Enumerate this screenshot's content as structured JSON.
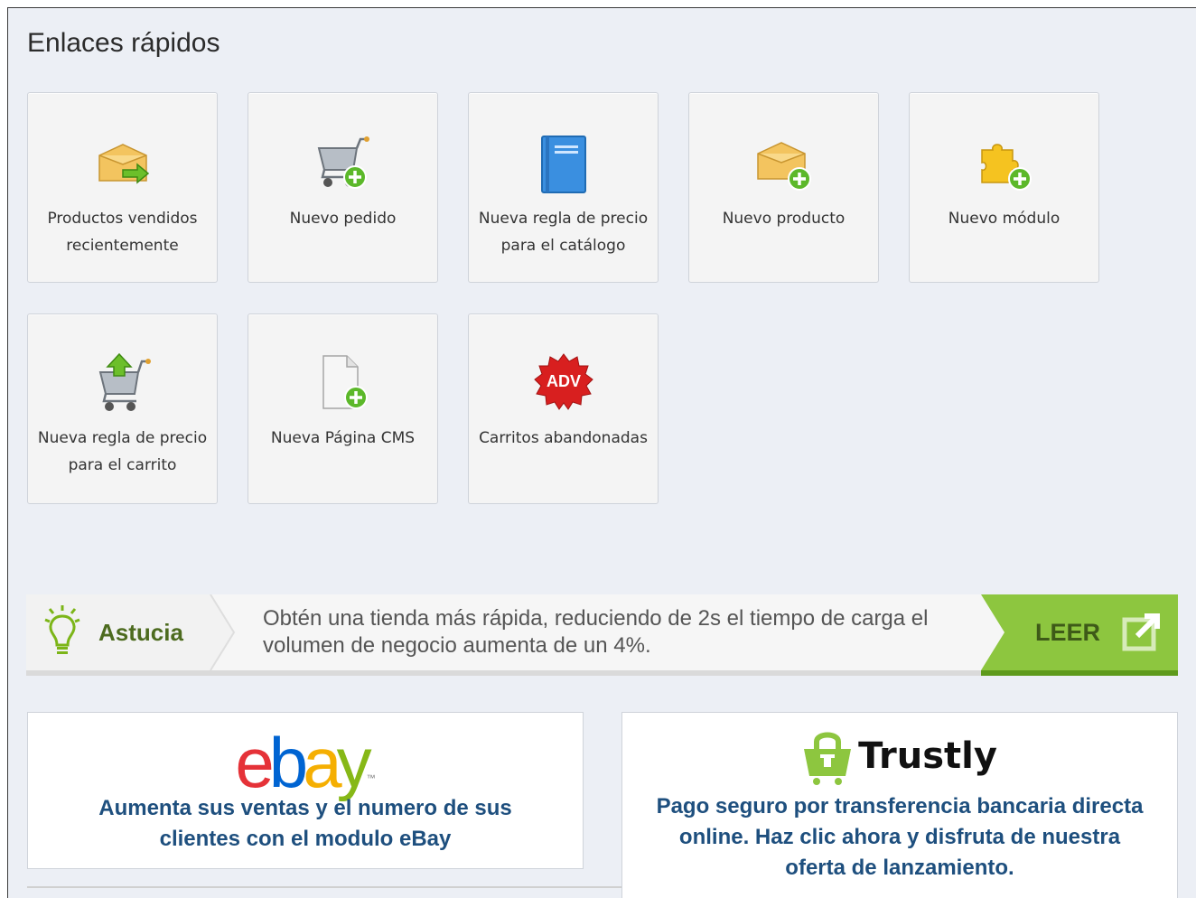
{
  "quick_links": {
    "title": "Enlaces rápidos",
    "tiles": [
      {
        "label": "Productos vendidos recientemente",
        "icon": "box-arrow-icon"
      },
      {
        "label": "Nuevo pedido",
        "icon": "cart-add-icon"
      },
      {
        "label": "Nueva regla de precio para el catálogo",
        "icon": "book-icon"
      },
      {
        "label": "Nuevo producto",
        "icon": "box-add-icon"
      },
      {
        "label": "Nuevo módulo",
        "icon": "puzzle-add-icon"
      },
      {
        "label": "Nueva regla de precio para el carrito",
        "icon": "cart-up-icon"
      },
      {
        "label": "Nueva Página CMS",
        "icon": "page-add-icon"
      },
      {
        "label": "Carritos abandonadas",
        "icon": "adv-badge-icon",
        "badge_text": "ADV"
      }
    ]
  },
  "tip": {
    "label": "Astucia",
    "text": "Obtén una tienda más rápida, reduciendo de 2s el tiempo de carga el volumen de negocio aumenta de un 4%.",
    "button": "LEER",
    "accent": "#8bc34a"
  },
  "promos": {
    "ebay": {
      "logo": [
        "e",
        "b",
        "a",
        "y"
      ],
      "tm": "™",
      "text": "Aumenta sus ventas y el numero de sus clientes con el modulo eBay"
    },
    "trustly": {
      "logo": "Trustly",
      "text": "Pago seguro por transferencia bancaria directa online. Haz clic ahora y disfruta de nuestra oferta de lanzamiento."
    }
  },
  "colors": {
    "text_blue": "#1e4f7e",
    "ebay_e": "#e53238",
    "ebay_b": "#0064d2",
    "ebay_a": "#f5af02",
    "ebay_y": "#86b817",
    "trustly_green": "#8dc63f"
  }
}
